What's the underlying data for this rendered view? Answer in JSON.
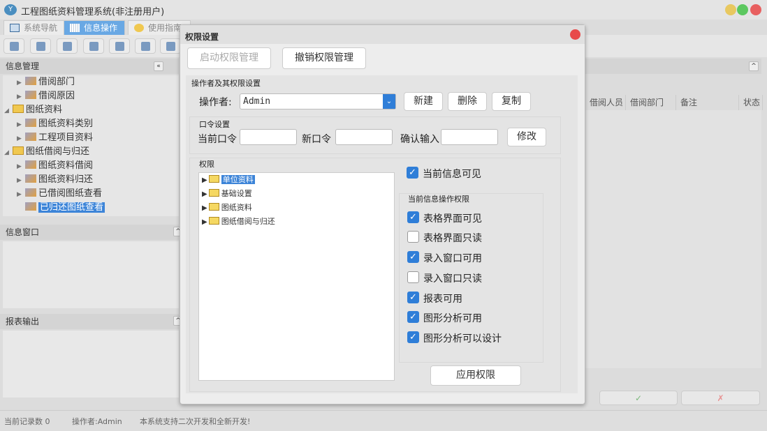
{
  "app": {
    "title": "工程图纸资料管理系统(非注册用户)",
    "logo": "Y"
  },
  "window_buttons": {
    "min": "#e8c860",
    "max": "#5cc860",
    "close": "#e86060"
  },
  "tabs": [
    {
      "label": "系统导航"
    },
    {
      "label": "信息操作",
      "active": true
    },
    {
      "label": "使用指南"
    }
  ],
  "toolbar_icons": [
    "search-icon",
    "list-icon",
    "document-icon",
    "user-icon",
    "monitor-icon",
    "export-icon",
    "window-icon"
  ],
  "left": {
    "info_manage": "信息管理",
    "tree": [
      {
        "label": "借阅部门",
        "level": 1,
        "icon": "wrench"
      },
      {
        "label": "借阅原因",
        "level": 1,
        "icon": "wrench"
      },
      {
        "label": "图纸资料",
        "level": 0,
        "icon": "folder",
        "expanded": true
      },
      {
        "label": "图纸资料类别",
        "level": 1,
        "icon": "wrench"
      },
      {
        "label": "工程项目资料",
        "level": 1,
        "icon": "wrench"
      },
      {
        "label": "图纸借阅与归还",
        "level": 0,
        "icon": "folder",
        "expanded": true
      },
      {
        "label": "图纸资料借阅",
        "level": 1,
        "icon": "wrench"
      },
      {
        "label": "图纸资料归还",
        "level": 1,
        "icon": "wrench"
      },
      {
        "label": "已借阅图纸查看",
        "level": 1,
        "icon": "wrench"
      },
      {
        "label": "已归还图纸查看",
        "level": 1,
        "icon": "wrench",
        "selected": true
      }
    ],
    "info_window": "信息窗口",
    "report_output": "报表输出"
  },
  "table": {
    "columns": [
      "借阅人员",
      "借阅部门",
      "备注",
      "状态"
    ]
  },
  "bottom_buttons": {
    "ok": "✓",
    "cancel": "✗"
  },
  "status": {
    "records": "当前记录数 0",
    "operator": "操作者:Admin",
    "note": "本系统支持二次开发和全新开发!"
  },
  "dialog": {
    "title": "权限设置",
    "enable_btn": "启动权限管理",
    "revoke_btn": "撤销权限管理",
    "operator_group": "操作者及其权限设置",
    "operator_label": "操作者:",
    "operator_value": "Admin",
    "new_btn": "新建",
    "delete_btn": "删除",
    "copy_btn": "复制",
    "password_group": "口令设置",
    "current_pwd": "当前口令",
    "new_pwd": "新口令",
    "confirm_pwd": "确认输入",
    "modify_btn": "修改",
    "perm_group": "权限",
    "perm_tree": [
      {
        "label": "单位资料",
        "selected": true
      },
      {
        "label": "基础设置"
      },
      {
        "label": "图纸资料"
      },
      {
        "label": "图纸借阅与归还"
      }
    ],
    "visible": {
      "label": "当前信息可见",
      "checked": true
    },
    "ops_group": "当前信息操作权限",
    "ops": [
      {
        "label": "表格界面可见",
        "checked": true
      },
      {
        "label": "表格界面只读",
        "checked": false
      },
      {
        "label": "录入窗口可用",
        "checked": true
      },
      {
        "label": "录入窗口只读",
        "checked": false
      },
      {
        "label": "报表可用",
        "checked": true
      },
      {
        "label": "图形分析可用",
        "checked": true
      },
      {
        "label": "图形分析可以设计",
        "checked": true
      }
    ],
    "apply_btn": "应用权限"
  }
}
